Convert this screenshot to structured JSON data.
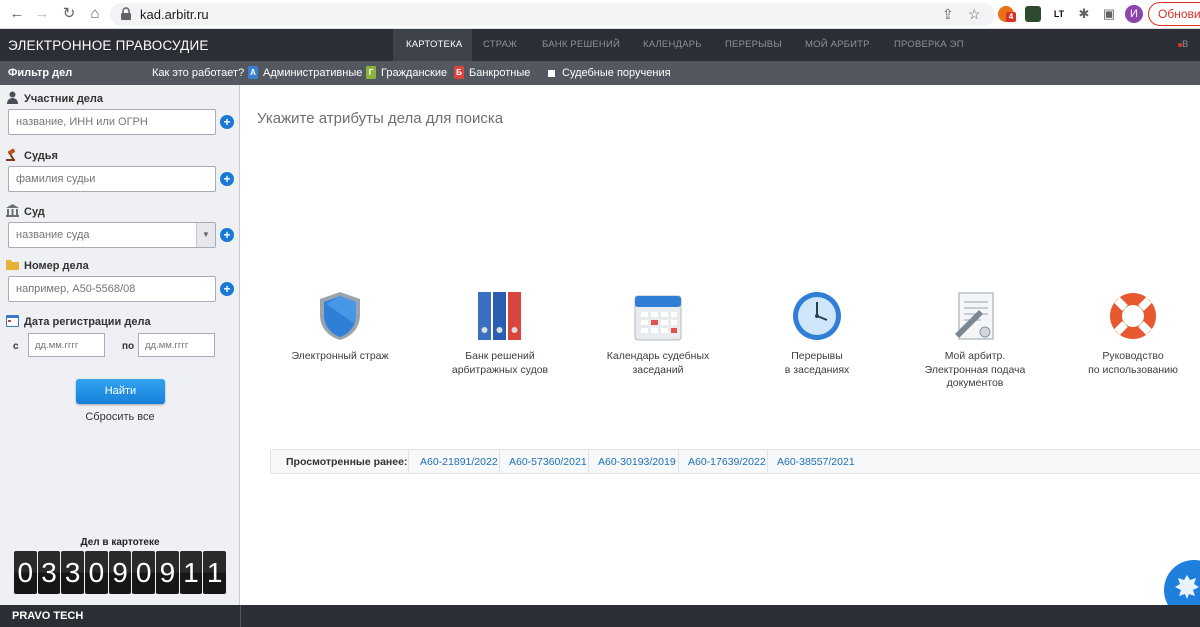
{
  "browser": {
    "url": "kad.arbitr.ru",
    "update_label": "Обновить",
    "profile_initial": "И",
    "ext_badge": "4",
    "ext_lt": "LT"
  },
  "header": {
    "site_title": "ЭЛЕКТРОННОЕ ПРАВОСУДИЕ",
    "nav": [
      "КАРТОТЕКА",
      "СТРАЖ",
      "БАНК РЕШЕНИЙ",
      "КАЛЕНДАРЬ",
      "ПЕРЕРЫВЫ",
      "МОЙ АРБИТР",
      "ПРОВЕРКА ЭП"
    ],
    "login": "В"
  },
  "subbar": {
    "filter_title": "Фильтр дел",
    "how": "Как это работает?",
    "types": [
      {
        "badge": "А",
        "label": "Административные",
        "color": "#3b7fd0"
      },
      {
        "badge": "Г",
        "label": "Гражданские",
        "color": "#8bb33a"
      },
      {
        "badge": "Б",
        "label": "Банкротные",
        "color": "#d9463e"
      }
    ],
    "checkbox_label": "Судебные поручения"
  },
  "sidebar": {
    "participant_label": "Участник дела",
    "participant_placeholder": "название, ИНН или ОГРН",
    "judge_label": "Судья",
    "judge_placeholder": "фамилия судьи",
    "court_label": "Суд",
    "court_placeholder": "название суда",
    "case_label": "Номер дела",
    "case_placeholder": "например, А50-5568/08",
    "date_label": "Дата регистрации дела",
    "date_from": "с",
    "date_to": "по",
    "date_placeholder": "дд.мм.гггг",
    "find": "Найти",
    "reset": "Сбросить все",
    "counter_label": "Дел в картотеке",
    "counter_digits": [
      "0",
      "3",
      "3",
      "0",
      "9",
      "0",
      "9",
      "1",
      "1"
    ]
  },
  "main": {
    "title": "Укажите атрибуты дела для поиска",
    "services": [
      {
        "line1": "Электронный страж",
        "line2": "",
        "line3": "",
        "icon": "shield-icon"
      },
      {
        "line1": "Банк решений",
        "line2": "арбитражных судов",
        "line3": "",
        "icon": "binders-icon"
      },
      {
        "line1": "Календарь судебных",
        "line2": "заседаний",
        "line3": "",
        "icon": "calendar-icon"
      },
      {
        "line1": "Перерывы",
        "line2": "в заседаниях",
        "line3": "",
        "icon": "clock-icon"
      },
      {
        "line1": "Мой арбитр.",
        "line2": "Электронная подача",
        "line3": "документов",
        "icon": "document-icon"
      },
      {
        "line1": "Руководство",
        "line2": "по использованию",
        "line3": "",
        "icon": "lifebuoy-icon"
      }
    ],
    "recent_label": "Просмотренные ранее:",
    "recent_cases": [
      "А60-21891/2022",
      "А60-57360/2021",
      "А60-30193/2019",
      "А60-17639/2022",
      "А60-38557/2021"
    ]
  },
  "footer": {
    "brand": "PRAVO TECH"
  }
}
